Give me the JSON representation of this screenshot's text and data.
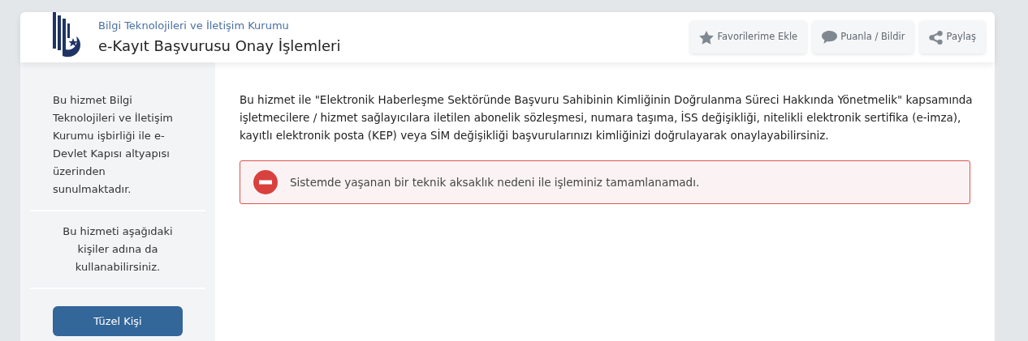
{
  "header": {
    "organization": "Bilgi Teknolojileri ve İletişim Kurumu",
    "title": "e-Kayıt Başvurusu Onay İşlemleri"
  },
  "actions": [
    {
      "kind": "star",
      "label": "Favorilerime Ekle"
    },
    {
      "kind": "comment",
      "label": "Puanla / Bildir"
    },
    {
      "kind": "share",
      "label": "Paylaş"
    }
  ],
  "sidebar": {
    "about": "Bu hizmet Bilgi Teknolojileri ve İletişim Kurumu işbirliği ile e-Devlet Kapısı altyapısı üzerinden sunulmaktadır.",
    "proxy_note": "Bu hizmeti aşağıdaki kişiler adına da kullanabilirsiniz.",
    "buttons": [
      "Tüzel Kişi"
    ]
  },
  "main": {
    "description": "Bu hizmet ile \"Elektronik Haberleşme Sektöründe Başvuru Sahibinin Kimliğinin Doğrulanma Süreci Hakkında Yönetmelik\" kapsamında işletmecilere / hizmet sağlayıcılara iletilen abonelik sözleşmesi, numara taşıma, İSS değişikliği, nitelikli elektronik sertifika (e-imza), kayıtlı elektronik posta (KEP) veya SİM değişikliği başvurularınızı kimliğinizi doğrulayarak onaylayabilirsiniz.",
    "alert": {
      "kind": "error",
      "message": "Sistemde yaşanan bir teknik aksaklık nedeni ile işleminiz tamamlanamadı."
    }
  }
}
